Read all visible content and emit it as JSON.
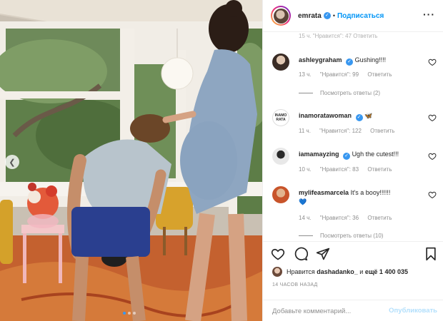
{
  "post": {
    "username": "emrata",
    "follow_label": "Подписаться",
    "more_icon": "more-horizontal-icon"
  },
  "photo": {
    "alt_subject": "photo-post",
    "prev_icon": "chevron-left-icon",
    "carousel_total": 3,
    "carousel_active": 1
  },
  "ghost_meta": "15 ч.   \"Нравится\": 47   Ответить",
  "comments": [
    {
      "user": "ashleygraham",
      "verified": true,
      "text": "Gushing!!!!",
      "time": "13 ч.",
      "likes": "\"Нравится\": 99",
      "reply": "Ответить",
      "replies": "Посмотреть ответы (2)"
    },
    {
      "user": "inamoratawoman",
      "verified": true,
      "text": "🦋",
      "time": "11 ч.",
      "likes": "\"Нравится\": 122",
      "reply": "Ответить",
      "avatar_text": "INAMO RATA"
    },
    {
      "user": "iamamayzing",
      "verified": true,
      "text": "Ugh the cutest!!!",
      "time": "10 ч.",
      "likes": "\"Нравится\": 83",
      "reply": "Ответить"
    },
    {
      "user": "mylifeasmarcela",
      "verified": false,
      "text": "It's a booy!!!!!!",
      "text2": "💙",
      "time": "14 ч.",
      "likes": "\"Нравится\": 36",
      "reply": "Ответить",
      "replies": "Посмотреть ответы (10)"
    }
  ],
  "likes_line": {
    "prefix": "Нравится",
    "user": "dashadanko_",
    "middle": "и",
    "count": "ещё 1 400 035"
  },
  "date_label": "14 ЧАСОВ НАЗАД",
  "comment_input": {
    "placeholder": "Добавьте комментарий...",
    "publish_label": "Опубликовать"
  },
  "colors": {
    "accent": "#0095f6",
    "publish_disabled": "#b2dffc",
    "meta_gray": "#8e8e8e"
  }
}
